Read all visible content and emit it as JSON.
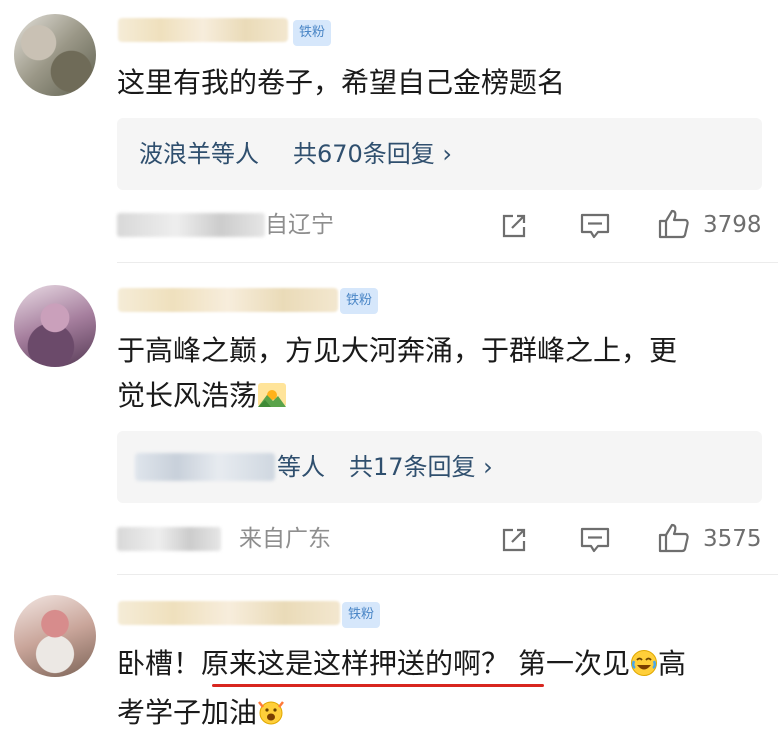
{
  "comments": [
    {
      "badge": "铁粉",
      "text": "这里有我的卷子，希望自己金榜题名",
      "reply_prefix": "波浪羊等人",
      "reply_count": "共670条回复 ›",
      "location": "自辽宁",
      "likes": "3798"
    },
    {
      "badge": "铁粉",
      "text_line1": "于高峰之巅，方见大河奔涌，于群峰之上，更",
      "text_line2": "觉长风浩荡",
      "reply_prefix": "等人",
      "reply_count": "共17条回复 ›",
      "location": "来自广东",
      "likes": "3575"
    },
    {
      "badge": "铁粉",
      "text_a": "卧槽！",
      "text_b": "原来这是这样押送的啊？",
      "text_c": "第一次见",
      "text_d": "高",
      "text_line2": "考学子加油"
    }
  ],
  "icons": [
    "share-icon",
    "comment-icon",
    "like-icon",
    "sunrise-emoji",
    "laugh-cry-emoji",
    "cheer-emoji"
  ],
  "colors": {
    "accent": "#2f4f6e",
    "badge_bg": "#d6e7fb",
    "badge_text": "#4a86c6",
    "underline": "#d8261f"
  }
}
